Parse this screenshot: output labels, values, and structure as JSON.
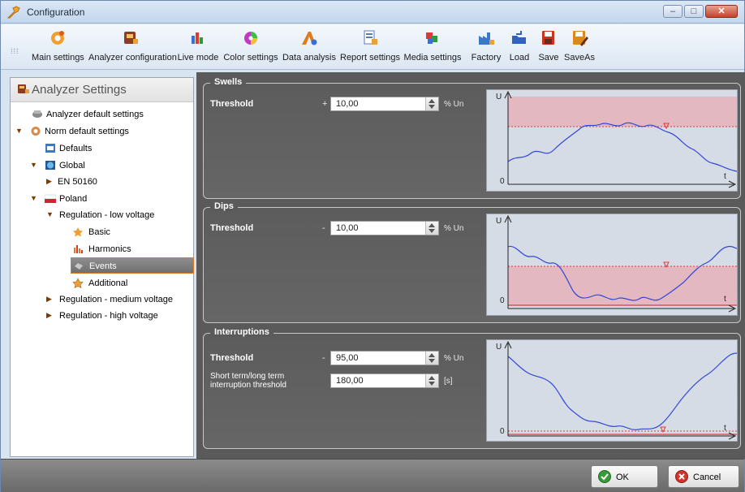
{
  "window": {
    "title": "Configuration"
  },
  "toolbar": {
    "items": [
      {
        "label": "Main settings",
        "icon": "gear-icon"
      },
      {
        "label": "Analyzer configuration",
        "icon": "analyzer-icon"
      },
      {
        "label": "Live mode",
        "icon": "live-chart-icon"
      },
      {
        "label": "Color settings",
        "icon": "color-wheel-icon"
      },
      {
        "label": "Data analysis",
        "icon": "data-analysis-icon"
      },
      {
        "label": "Report settings",
        "icon": "report-icon"
      },
      {
        "label": "Media settings",
        "icon": "media-icon"
      },
      {
        "label": "Factory",
        "icon": "factory-icon"
      },
      {
        "label": "Load",
        "icon": "load-icon"
      },
      {
        "label": "Save",
        "icon": "save-icon"
      },
      {
        "label": "SaveAs",
        "icon": "save-as-icon"
      }
    ]
  },
  "tree": {
    "header": "Analyzer Settings",
    "nodes": [
      {
        "label": "Analyzer default settings",
        "icon": "analyzer-icon"
      },
      {
        "label": "Norm default settings",
        "icon": "norm-icon"
      },
      {
        "label": "Defaults",
        "icon": "defaults-icon"
      },
      {
        "label": "Global",
        "icon": "globe-icon"
      },
      {
        "label": "EN 50160",
        "icon": ""
      },
      {
        "label": "Poland",
        "icon": "poland-flag-icon"
      },
      {
        "label": "Regulation - low voltage",
        "icon": ""
      },
      {
        "label": "Basic",
        "icon": "star-icon"
      },
      {
        "label": "Harmonics",
        "icon": "harmonics-icon"
      },
      {
        "label": "Events",
        "icon": "events-icon"
      },
      {
        "label": "Additional",
        "icon": "additional-icon"
      },
      {
        "label": "Regulation - medium voltage",
        "icon": ""
      },
      {
        "label": "Regulation - high voltage",
        "icon": ""
      }
    ]
  },
  "swells": {
    "title": "Swells",
    "threshold_label": "Threshold",
    "sign": "+",
    "value": "10,00",
    "unit": "% Un"
  },
  "dips": {
    "title": "Dips",
    "threshold_label": "Threshold",
    "sign": "-",
    "value": "10,00",
    "unit": "% Un"
  },
  "interruptions": {
    "title": "Interruptions",
    "threshold_label": "Threshold",
    "sign": "-",
    "value": "95,00",
    "unit": "% Un",
    "term_label_line1": "Short term/long term",
    "term_label_line2": "interruption threshold",
    "term_value": "180,00",
    "term_unit": "[s]"
  },
  "graph": {
    "y_axis": "U",
    "x_axis": "t",
    "origin": "0"
  },
  "buttons": {
    "ok": "OK",
    "cancel": "Cancel"
  },
  "colors": {
    "band": "#e4b8c0",
    "threshold": "#e0393a",
    "signal": "#3048d8",
    "selection_border": "#e07b1f"
  }
}
